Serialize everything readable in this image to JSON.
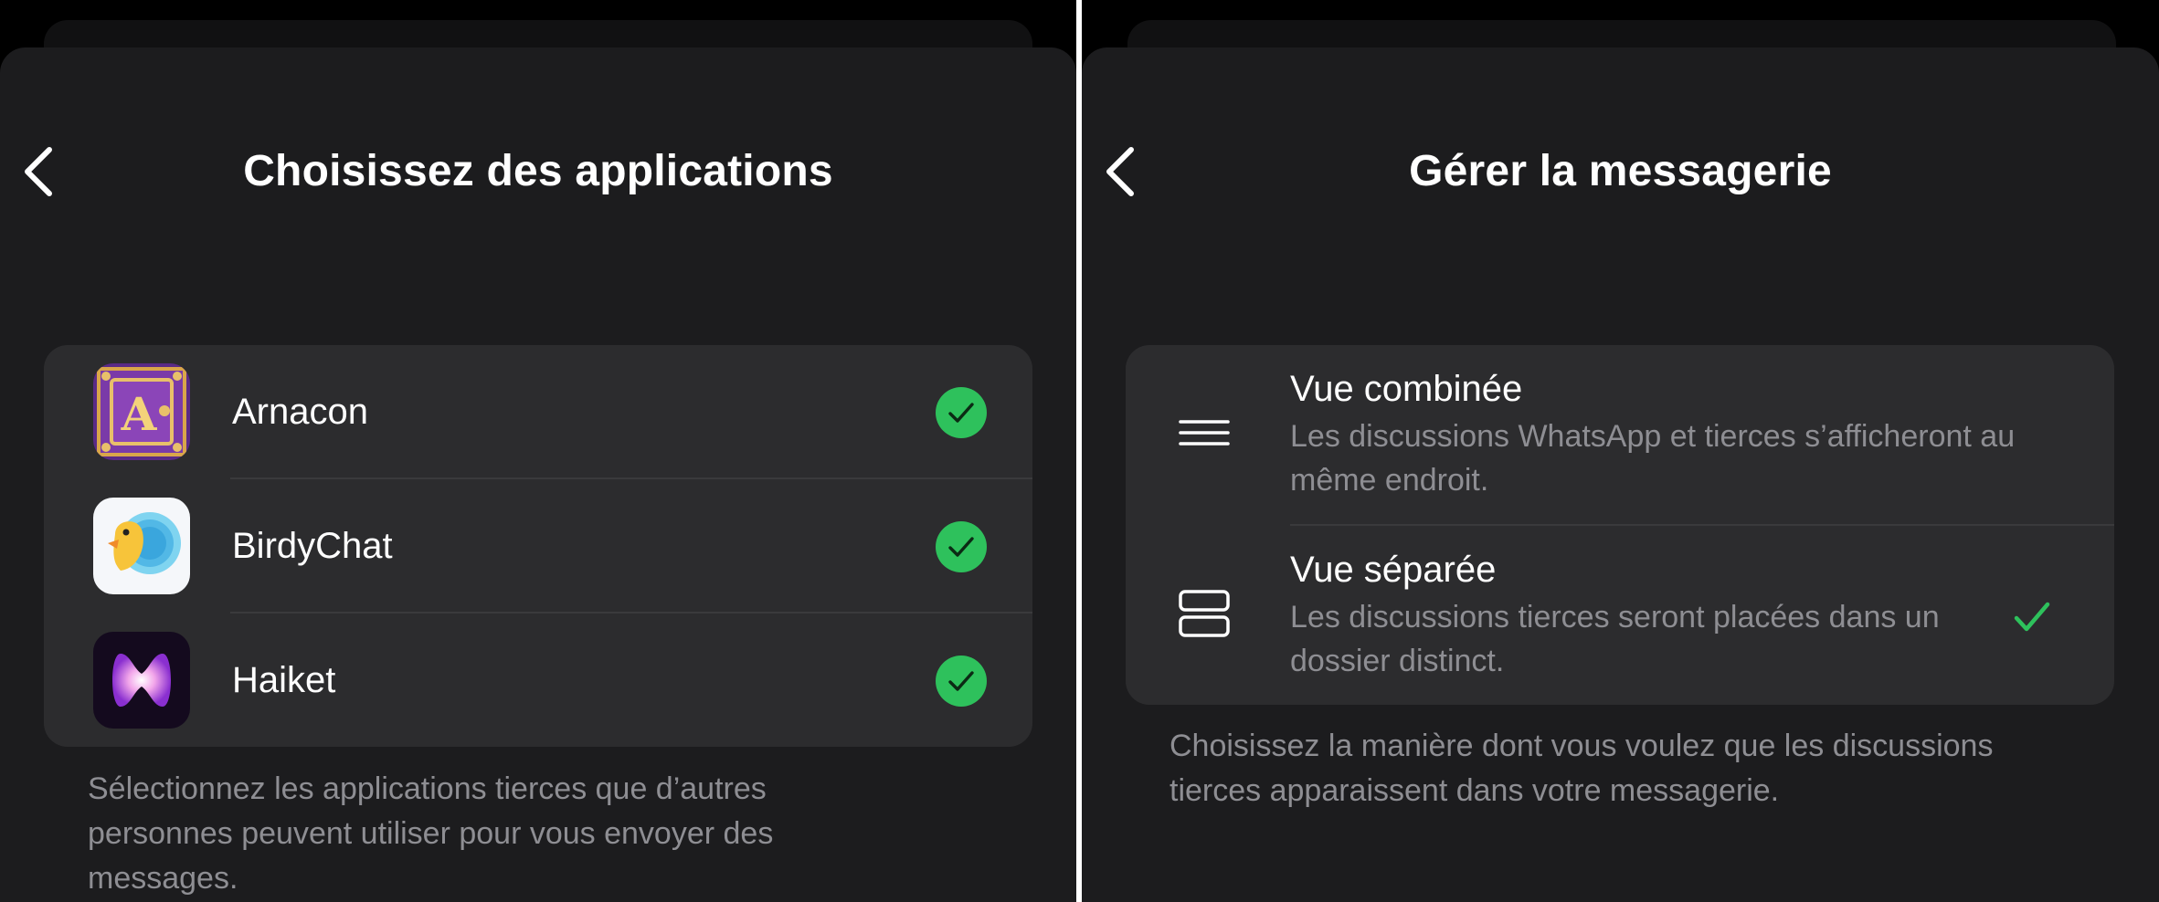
{
  "left_screen": {
    "title": "Choisissez des applications",
    "apps": [
      {
        "name": "Arnacon",
        "selected": true
      },
      {
        "name": "BirdyChat",
        "selected": true
      },
      {
        "name": "Haiket",
        "selected": true
      }
    ],
    "footer": "Sélectionnez les applications tierces que d’autres personnes peuvent utiliser pour vous envoyer des messages."
  },
  "right_screen": {
    "title": "Gérer la messagerie",
    "options": [
      {
        "title": "Vue combinée",
        "description": "Les discussions WhatsApp et tierces s’afficheront au même endroit.",
        "icon": "combined-view-icon",
        "selected": false
      },
      {
        "title": "Vue séparée",
        "description": "Les discussions tierces seront placées dans un dossier distinct.",
        "icon": "separated-view-icon",
        "selected": true
      }
    ],
    "footer": "Choisissez la manière dont vous voulez que les discussions tierces apparaissent dans votre messagerie."
  },
  "colors": {
    "background": "#000000",
    "sheet": "#1c1c1e",
    "card": "#2c2c2e",
    "text_primary": "#ffffff",
    "text_secondary": "#8e8e93",
    "check_green": "#2ec15c"
  }
}
